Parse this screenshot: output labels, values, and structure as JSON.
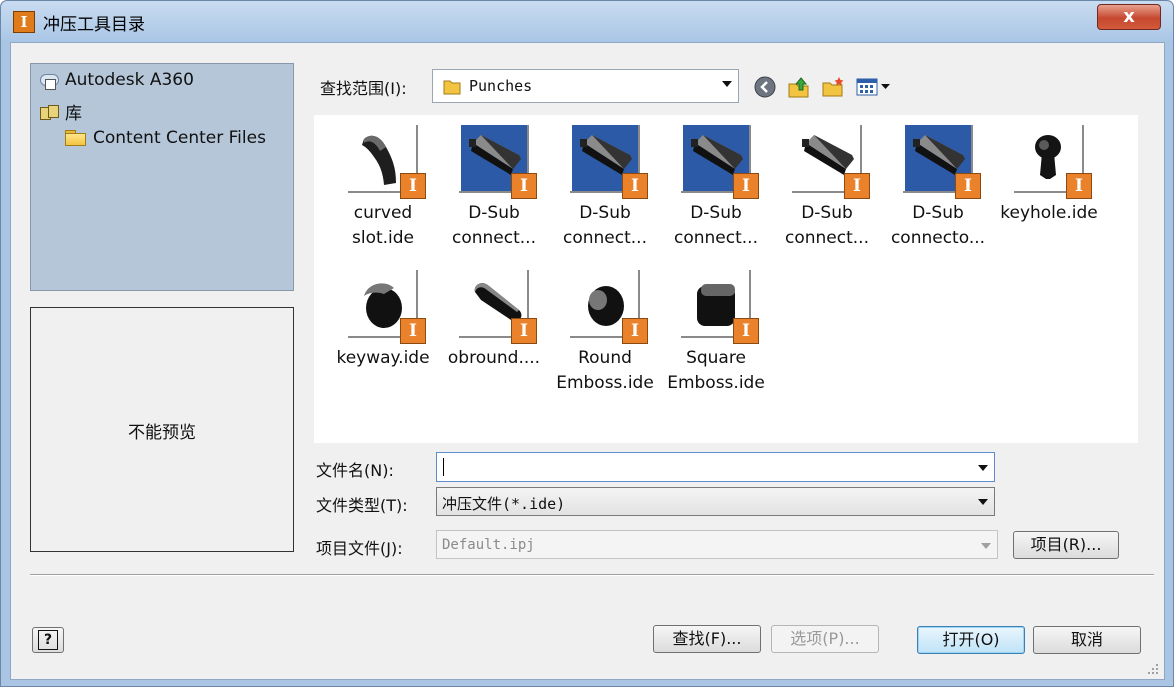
{
  "window": {
    "title": "冲压工具目录",
    "close_label": "x",
    "app_icon_label": "I"
  },
  "nav": {
    "items": [
      {
        "label": "Autodesk A360",
        "icon": "a360-icon"
      },
      {
        "label": "库",
        "icon": "library-icon"
      },
      {
        "label": "Content Center Files",
        "icon": "folder-icon"
      }
    ]
  },
  "preview": {
    "text": "不能预览"
  },
  "lookin": {
    "label": "查找范围(I):",
    "value": "Punches"
  },
  "toolbar": {
    "icons": [
      "back-icon",
      "up-folder-icon",
      "new-folder-icon",
      "views-menu-icon"
    ]
  },
  "files": [
    {
      "line1": "curved",
      "line2": "slot.ide",
      "shape": "curved",
      "bg": false
    },
    {
      "line1": "D-Sub",
      "line2": "connect...",
      "shape": "dsub",
      "bg": true
    },
    {
      "line1": "D-Sub",
      "line2": "connect...",
      "shape": "dsub",
      "bg": true
    },
    {
      "line1": "D-Sub",
      "line2": "connect...",
      "shape": "dsub",
      "bg": true
    },
    {
      "line1": "D-Sub",
      "line2": "connect...",
      "shape": "dsub",
      "bg": false
    },
    {
      "line1": "D-Sub",
      "line2": "connecto...",
      "shape": "dsub",
      "bg": true
    },
    {
      "line1": "keyhole.ide",
      "line2": "",
      "shape": "keyhole",
      "bg": false
    },
    {
      "line1": "keyway.ide",
      "line2": "",
      "shape": "keyway",
      "bg": false
    },
    {
      "line1": "obround....",
      "line2": "",
      "shape": "obround",
      "bg": false
    },
    {
      "line1": "Round",
      "line2": "Emboss.ide",
      "shape": "round",
      "bg": false
    },
    {
      "line1": "Square",
      "line2": "Emboss.ide",
      "shape": "square",
      "bg": false
    }
  ],
  "badge_letter": "I",
  "filename": {
    "label": "文件名(N):",
    "value": ""
  },
  "filetype": {
    "label": "文件类型(T):",
    "value": "冲压文件(*.ide)"
  },
  "project": {
    "label": "项目文件(J):",
    "value": "Default.ipj",
    "button": "项目(R)..."
  },
  "buttons": {
    "help": "?",
    "find": "查找(F)...",
    "options": "选项(P)...",
    "open": "打开(O)",
    "cancel": "取消"
  }
}
